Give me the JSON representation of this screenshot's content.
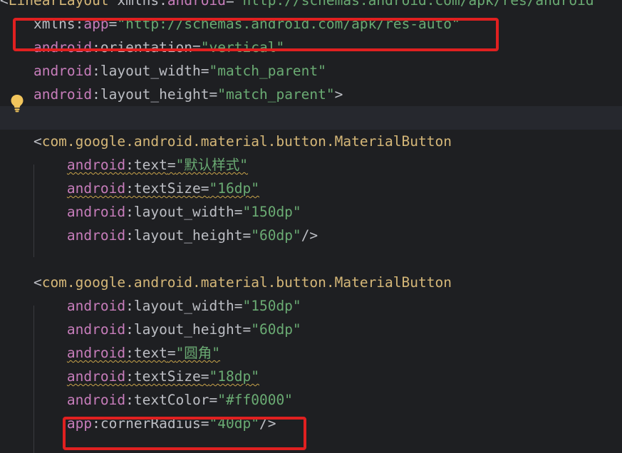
{
  "editor": {
    "lines": [
      {
        "parts": [
          {
            "t": "<",
            "c": "punct"
          },
          {
            "t": "LinearLayout",
            "c": "tag"
          },
          {
            "t": " xmlns",
            "c": "attr"
          },
          {
            "t": ":",
            "c": "punct"
          },
          {
            "t": "android",
            "c": "ns"
          },
          {
            "t": "=",
            "c": "punct"
          },
          {
            "t": "\"http://schemas.android.com/apk/res/android\"",
            "c": "str"
          }
        ]
      },
      {
        "parts": [
          {
            "t": "    xmlns",
            "c": "attr"
          },
          {
            "t": ":",
            "c": "punct"
          },
          {
            "t": "app",
            "c": "ns"
          },
          {
            "t": "=",
            "c": "punct"
          },
          {
            "t": "\"http://schemas.android.com/apk/res-auto\"",
            "c": "str"
          }
        ]
      },
      {
        "parts": [
          {
            "t": "    ",
            "c": "punct"
          },
          {
            "t": "android",
            "c": "ns"
          },
          {
            "t": ":orientation",
            "c": "attr"
          },
          {
            "t": "=",
            "c": "punct"
          },
          {
            "t": "\"vertical\"",
            "c": "str"
          }
        ]
      },
      {
        "parts": [
          {
            "t": "    ",
            "c": "punct"
          },
          {
            "t": "android",
            "c": "ns"
          },
          {
            "t": ":layout_width",
            "c": "attr"
          },
          {
            "t": "=",
            "c": "punct"
          },
          {
            "t": "\"match_parent\"",
            "c": "str"
          }
        ]
      },
      {
        "parts": [
          {
            "t": "    ",
            "c": "punct"
          },
          {
            "t": "android",
            "c": "ns"
          },
          {
            "t": ":layout_height",
            "c": "attr"
          },
          {
            "t": "=",
            "c": "punct"
          },
          {
            "t": "\"match_parent\"",
            "c": "str"
          },
          {
            "t": ">",
            "c": "punct"
          }
        ]
      },
      {
        "parts": []
      },
      {
        "parts": [
          {
            "t": "    <",
            "c": "punct"
          },
          {
            "t": "com.google.android.material.button.MaterialButton",
            "c": "tag"
          }
        ]
      },
      {
        "parts": [
          {
            "t": "        ",
            "c": "punct"
          },
          {
            "t": "android",
            "c": "ns",
            "w": true
          },
          {
            "t": ":text",
            "c": "attr",
            "w": true
          },
          {
            "t": "=",
            "c": "punct",
            "w": true
          },
          {
            "t": "\"默认样式\"",
            "c": "str",
            "w": true
          }
        ]
      },
      {
        "parts": [
          {
            "t": "        ",
            "c": "punct"
          },
          {
            "t": "android",
            "c": "ns",
            "w": true
          },
          {
            "t": ":textSize",
            "c": "attr",
            "w": true
          },
          {
            "t": "=",
            "c": "punct",
            "w": true
          },
          {
            "t": "\"16dp\"",
            "c": "str",
            "w": true
          }
        ]
      },
      {
        "parts": [
          {
            "t": "        ",
            "c": "punct"
          },
          {
            "t": "android",
            "c": "ns"
          },
          {
            "t": ":layout_width",
            "c": "attr"
          },
          {
            "t": "=",
            "c": "punct"
          },
          {
            "t": "\"150dp\"",
            "c": "str"
          }
        ]
      },
      {
        "parts": [
          {
            "t": "        ",
            "c": "punct"
          },
          {
            "t": "android",
            "c": "ns"
          },
          {
            "t": ":layout_height",
            "c": "attr"
          },
          {
            "t": "=",
            "c": "punct"
          },
          {
            "t": "\"60dp\"",
            "c": "str"
          },
          {
            "t": "/>",
            "c": "punct"
          }
        ]
      },
      {
        "parts": []
      },
      {
        "parts": [
          {
            "t": "    <",
            "c": "punct"
          },
          {
            "t": "com.google.android.material.button.MaterialButton",
            "c": "tag"
          }
        ]
      },
      {
        "parts": [
          {
            "t": "        ",
            "c": "punct"
          },
          {
            "t": "android",
            "c": "ns"
          },
          {
            "t": ":layout_width",
            "c": "attr"
          },
          {
            "t": "=",
            "c": "punct"
          },
          {
            "t": "\"150dp\"",
            "c": "str"
          }
        ]
      },
      {
        "parts": [
          {
            "t": "        ",
            "c": "punct"
          },
          {
            "t": "android",
            "c": "ns"
          },
          {
            "t": ":layout_height",
            "c": "attr"
          },
          {
            "t": "=",
            "c": "punct"
          },
          {
            "t": "\"60dp\"",
            "c": "str"
          }
        ]
      },
      {
        "parts": [
          {
            "t": "        ",
            "c": "punct"
          },
          {
            "t": "android",
            "c": "ns",
            "w": true
          },
          {
            "t": ":text",
            "c": "attr",
            "w": true
          },
          {
            "t": "=",
            "c": "punct",
            "w": true
          },
          {
            "t": "\"圆角\"",
            "c": "str",
            "w": true
          }
        ]
      },
      {
        "parts": [
          {
            "t": "        ",
            "c": "punct"
          },
          {
            "t": "android",
            "c": "ns",
            "w": true
          },
          {
            "t": ":textSize",
            "c": "attr",
            "w": true
          },
          {
            "t": "=",
            "c": "punct",
            "w": true
          },
          {
            "t": "\"18dp\"",
            "c": "str",
            "w": true
          }
        ]
      },
      {
        "parts": [
          {
            "t": "        ",
            "c": "punct"
          },
          {
            "t": "android",
            "c": "ns"
          },
          {
            "t": ":textColor",
            "c": "attr"
          },
          {
            "t": "=",
            "c": "punct"
          },
          {
            "t": "\"#ff0000\"",
            "c": "str"
          }
        ]
      },
      {
        "parts": [
          {
            "t": "        ",
            "c": "punct"
          },
          {
            "t": "app",
            "c": "ns"
          },
          {
            "t": ":cornerRadius",
            "c": "attr"
          },
          {
            "t": "=",
            "c": "punct"
          },
          {
            "t": "\"40dp\"",
            "c": "str"
          },
          {
            "t": "/>",
            "c": "punct"
          }
        ]
      }
    ],
    "current_line_index": 5,
    "highlighted_line_indexes": [
      1,
      18
    ],
    "intention_icon": "lightbulb-icon"
  },
  "colors": {
    "background": "#1e1f22",
    "tag": "#d5b778",
    "namespace": "#c77dbb",
    "string": "#6aab73",
    "text": "#bcbec4",
    "highlight_box": "#e02020",
    "warning_squiggle": "#c9a44a",
    "bulb": "#f2c55c"
  }
}
